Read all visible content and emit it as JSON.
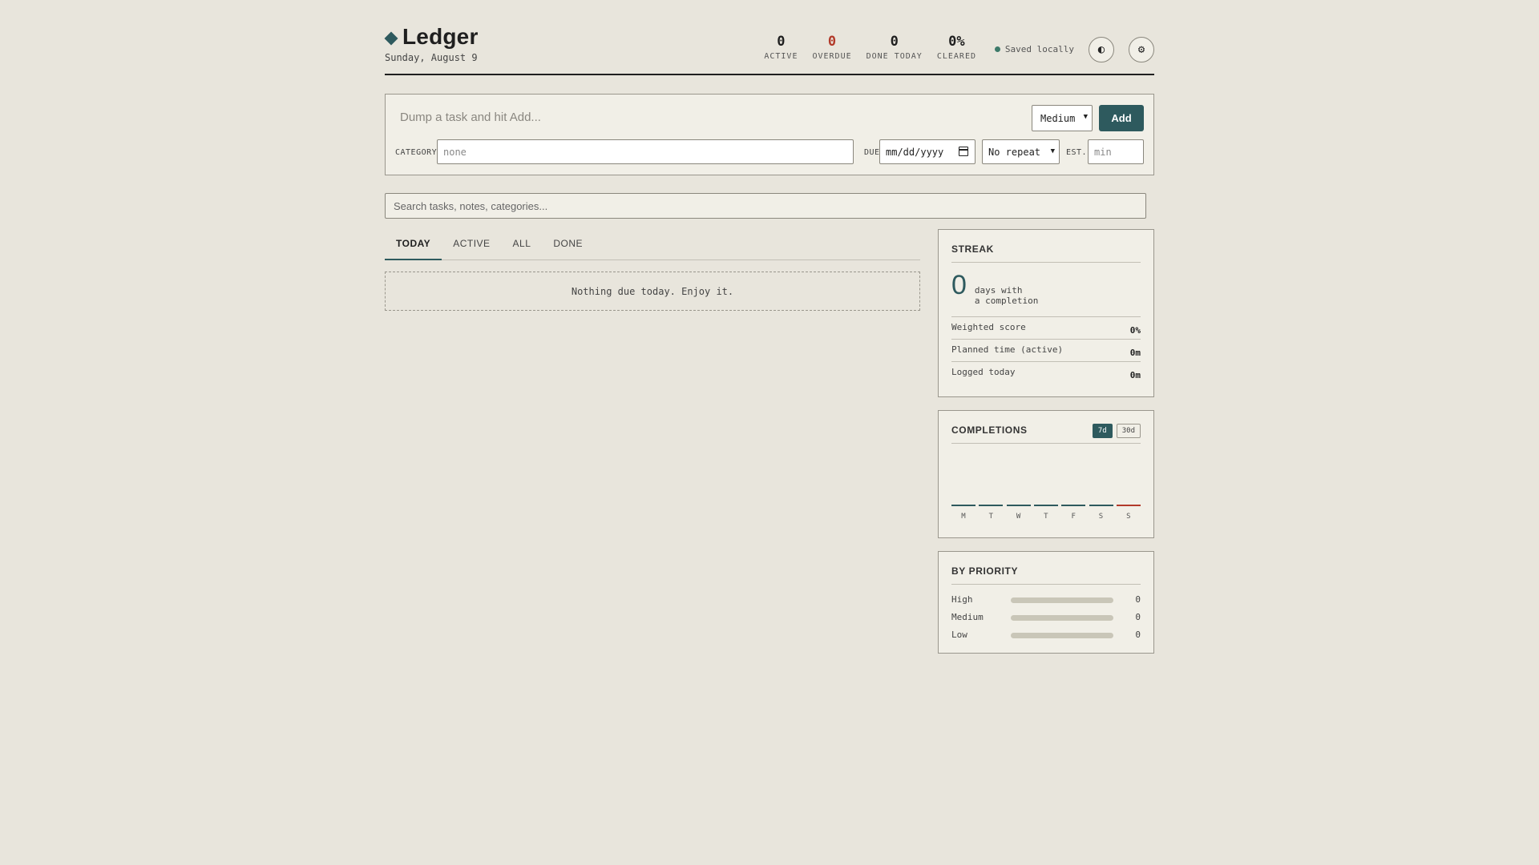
{
  "header": {
    "brand": "Ledger",
    "date": "Sunday, August 9",
    "stats": [
      {
        "value": "0",
        "label": "ACTIVE"
      },
      {
        "value": "0",
        "label": "OVERDUE"
      },
      {
        "value": "0",
        "label": "DONE TODAY"
      },
      {
        "value": "0%",
        "label": "CLEARED"
      }
    ],
    "saved_status": "Saved locally",
    "theme_icon": "◐",
    "settings_icon": "⚙"
  },
  "composer": {
    "task_placeholder": "Dump a task and hit Add...",
    "priority_selected": "Medium",
    "add_label": "Add",
    "category_label": "CATEGORY",
    "category_placeholder": "none",
    "due_label": "DUE",
    "due_placeholder": "mm/dd/yyyy",
    "repeat_selected": "No repeat",
    "est_label": "EST.",
    "est_placeholder": "min"
  },
  "search": {
    "placeholder": "Search tasks, notes, categories..."
  },
  "tabs": [
    "TODAY",
    "ACTIVE",
    "ALL",
    "DONE"
  ],
  "active_tab": "TODAY",
  "empty_message": "Nothing due today. Enjoy it.",
  "streak": {
    "title": "STREAK",
    "count": "0",
    "caption_line1": "days with",
    "caption_line2": "a completion",
    "rows": [
      {
        "label": "Weighted score",
        "value": "0%"
      },
      {
        "label": "Planned time (active)",
        "value": "0m"
      },
      {
        "label": "Logged today",
        "value": "0m"
      }
    ]
  },
  "completions": {
    "title": "COMPLETIONS",
    "ranges": [
      "7d",
      "30d"
    ],
    "selected_range": "7d",
    "days": [
      "M",
      "T",
      "W",
      "T",
      "F",
      "S",
      "S"
    ],
    "values": [
      0,
      0,
      0,
      0,
      0,
      0,
      0
    ]
  },
  "by_priority": {
    "title": "BY PRIORITY",
    "rows": [
      {
        "label": "High",
        "count": "0"
      },
      {
        "label": "Medium",
        "count": "0"
      },
      {
        "label": "Low",
        "count": "0"
      }
    ]
  },
  "colors": {
    "accent": "#2e5a5e",
    "danger": "#b23a2a",
    "background": "#e8e5dc"
  }
}
